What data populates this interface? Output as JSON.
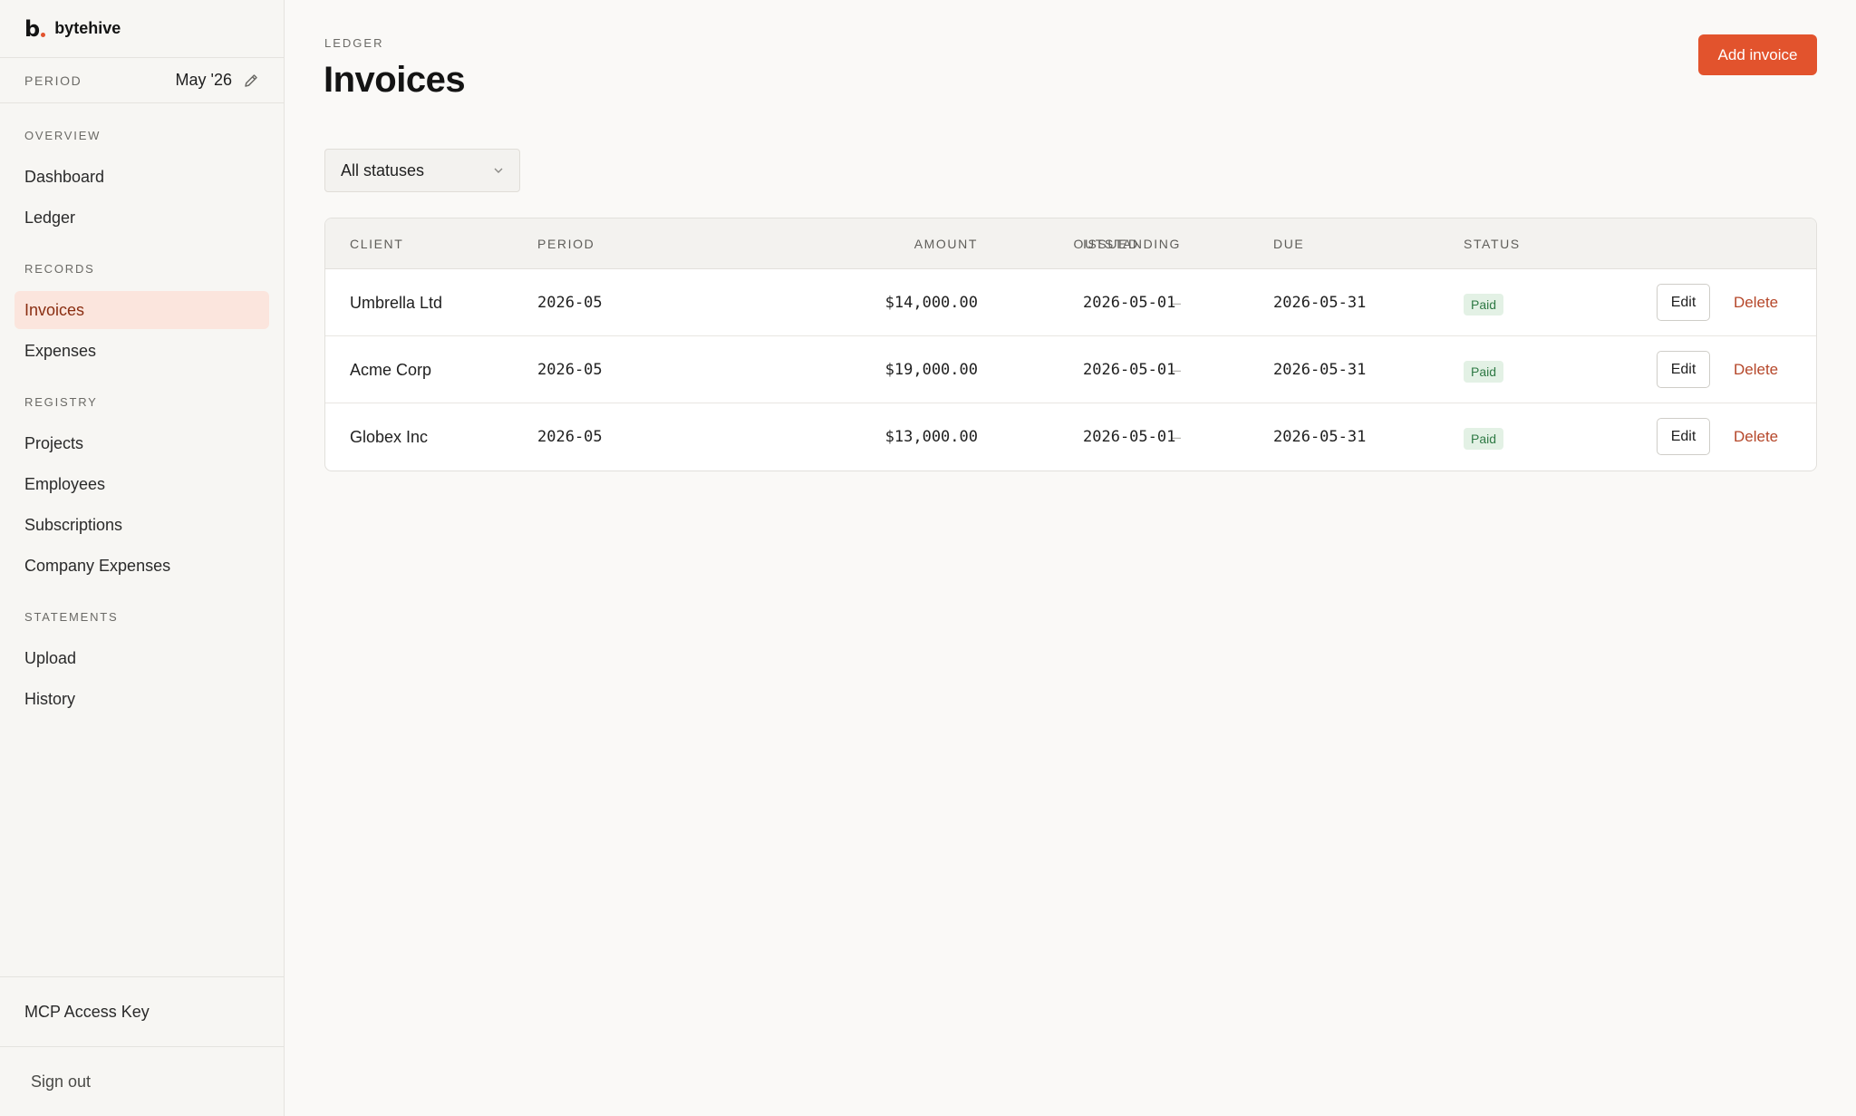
{
  "brand": {
    "logo_letter": "b",
    "name": "bytehive"
  },
  "period": {
    "label": "PERIOD",
    "value": "May '26"
  },
  "nav": {
    "sections": [
      {
        "heading": "OVERVIEW",
        "items": [
          {
            "label": "Dashboard"
          },
          {
            "label": "Ledger"
          }
        ]
      },
      {
        "heading": "RECORDS",
        "items": [
          {
            "label": "Invoices",
            "active": true
          },
          {
            "label": "Expenses"
          }
        ]
      },
      {
        "heading": "REGISTRY",
        "items": [
          {
            "label": "Projects"
          },
          {
            "label": "Employees"
          },
          {
            "label": "Subscriptions"
          },
          {
            "label": "Company Expenses"
          }
        ]
      },
      {
        "heading": "STATEMENTS",
        "items": [
          {
            "label": "Upload"
          },
          {
            "label": "History"
          }
        ]
      }
    ]
  },
  "sidebar_footer": {
    "mcp_label": "MCP Access Key",
    "signout_label": "Sign out"
  },
  "page": {
    "eyebrow": "LEDGER",
    "title": "Invoices",
    "add_button": "Add invoice"
  },
  "filter": {
    "selected": "All statuses"
  },
  "table": {
    "columns": [
      "CLIENT",
      "PERIOD",
      "AMOUNT",
      "OUTSTANDING",
      "ISSUED",
      "DUE",
      "STATUS"
    ],
    "rows": [
      {
        "client": "Umbrella Ltd",
        "period": "2026-05",
        "amount": "$14,000.00",
        "outstanding": "–",
        "issued": "2026-05-01",
        "due": "2026-05-31",
        "status": "Paid",
        "edit": "Edit",
        "delete": "Delete"
      },
      {
        "client": "Acme Corp",
        "period": "2026-05",
        "amount": "$19,000.00",
        "outstanding": "–",
        "issued": "2026-05-01",
        "due": "2026-05-31",
        "status": "Paid",
        "edit": "Edit",
        "delete": "Delete"
      },
      {
        "client": "Globex Inc",
        "period": "2026-05",
        "amount": "$13,000.00",
        "outstanding": "–",
        "issued": "2026-05-01",
        "due": "2026-05-31",
        "status": "Paid",
        "edit": "Edit",
        "delete": "Delete"
      }
    ]
  },
  "colors": {
    "accent": "#e2532d",
    "active_nav_bg": "#fbe5dd",
    "paid_badge_bg": "#e3f1e5",
    "paid_badge_text": "#2f7a45",
    "delete_text": "#b5472a"
  }
}
